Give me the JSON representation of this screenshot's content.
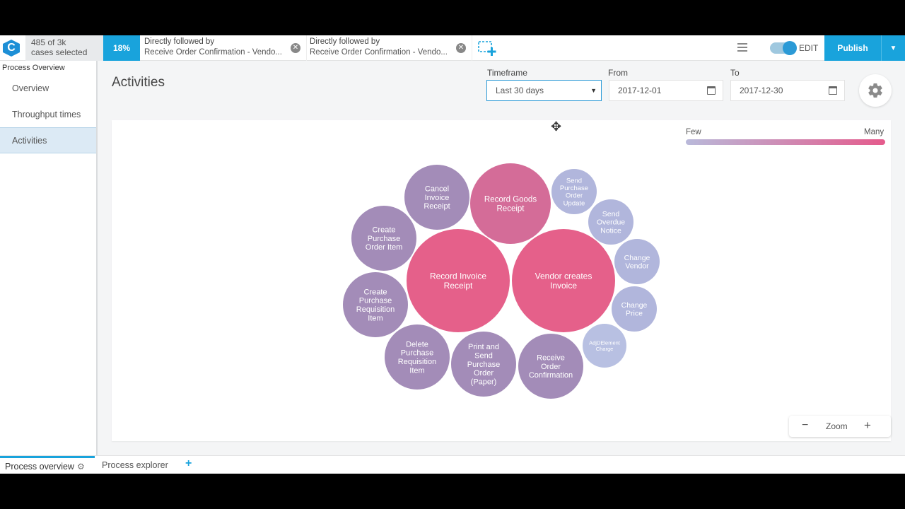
{
  "topbar": {
    "logo_letter": "C",
    "cases_line1": "485 of 3k",
    "cases_line2": "cases selected",
    "percent": "18%",
    "filters": [
      {
        "title": "Directly followed by",
        "subtitle": "Receive Order Confirmation - Vendo..."
      },
      {
        "title": "Directly followed by",
        "subtitle": "Receive Order Confirmation - Vendo..."
      }
    ],
    "edit_label": "EDIT",
    "publish_label": "Publish",
    "accent_color": "#19a3dc"
  },
  "sidebar": {
    "title": "Process Overview",
    "items": [
      {
        "label": "Overview",
        "active": false
      },
      {
        "label": "Throughput times",
        "active": false
      },
      {
        "label": "Activities",
        "active": true
      }
    ]
  },
  "main": {
    "title": "Activities",
    "timeframe_label": "Timeframe",
    "timeframe_value": "Last 30 days",
    "from_label": "From",
    "from_value": "2017-12-01",
    "to_label": "To",
    "to_value": "2017-12-30"
  },
  "legend": {
    "few": "Few",
    "many": "Many",
    "color_few": "#b9b9da",
    "color_many": "#e55b8c"
  },
  "bubbles": [
    {
      "label": [
        "Record Invoice",
        "Receipt"
      ],
      "color": "#e5608a"
    },
    {
      "label": [
        "Vendor creates",
        "Invoice"
      ],
      "color": "#e5608a"
    },
    {
      "label": [
        "Record Goods",
        "Receipt"
      ],
      "color": "#d46c98"
    },
    {
      "label": [
        "Cancel",
        "Invoice",
        "Receipt"
      ],
      "color": "#a38cb8"
    },
    {
      "label": [
        "Create",
        "Purchase",
        "Order Item"
      ],
      "color": "#a38cb8"
    },
    {
      "label": [
        "Create",
        "Purchase",
        "Requisition",
        "Item"
      ],
      "color": "#a38cb8"
    },
    {
      "label": [
        "Delete",
        "Purchase",
        "Requisition",
        "Item"
      ],
      "color": "#a38cb8"
    },
    {
      "label": [
        "Print and",
        "Send",
        "Purchase",
        "Order",
        "(Paper)"
      ],
      "color": "#a38cb8"
    },
    {
      "label": [
        "Receive",
        "Order",
        "Confirmation"
      ],
      "color": "#a38cb8"
    },
    {
      "label": [
        "Send",
        "Purchase",
        "Order",
        "Update"
      ],
      "color": "#b1b6dc"
    },
    {
      "label": [
        "Send",
        "Overdue",
        "Notice"
      ],
      "color": "#b1b6dc"
    },
    {
      "label": [
        "Change",
        "Vendor"
      ],
      "color": "#b1b6dc"
    },
    {
      "label": [
        "Change",
        "Price"
      ],
      "color": "#b1b6dc"
    },
    {
      "label": [
        "AdjDElement",
        "Charge"
      ],
      "color": "#b8c0e2"
    }
  ],
  "zoom": {
    "label": "Zoom",
    "minus": "−",
    "plus": "+"
  },
  "bottom_tabs": [
    {
      "label": "Process overview",
      "active": true
    },
    {
      "label": "Process explorer",
      "active": false
    }
  ]
}
